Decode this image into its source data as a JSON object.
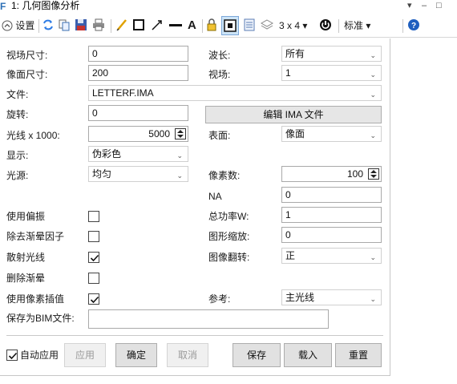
{
  "window": {
    "title": "1: 几何图像分析",
    "icon_letter": "F",
    "controls": [
      "▾",
      "–",
      "□"
    ]
  },
  "toolbar": {
    "settings_label": "设置",
    "grid_label": "3 x 4 ▾",
    "standard_label": "标准 ▾",
    "text_tool": "A"
  },
  "form": {
    "field_size": {
      "label": "视场尺寸:",
      "value": "0"
    },
    "image_size": {
      "label": "像面尺寸:",
      "value": "200"
    },
    "file": {
      "label": "文件:",
      "value": "LETTERF.IMA"
    },
    "rotation": {
      "label": "旋转:",
      "value": "0"
    },
    "rays": {
      "label": "光线 x 1000:",
      "value": "5000"
    },
    "display": {
      "label": "显示:",
      "value": "伪彩色"
    },
    "source": {
      "label": "光源:",
      "value": "均匀"
    },
    "wavelength": {
      "label": "波长:",
      "value": "所有"
    },
    "field": {
      "label": "视场:",
      "value": "1"
    },
    "edit_ima_button": "编辑 IMA 文件",
    "surface": {
      "label": "表面:",
      "value": "像面"
    },
    "pixels": {
      "label": "像素数:",
      "value": "100"
    },
    "na": {
      "label": "NA",
      "value": "0"
    },
    "total_power": {
      "label": "总功率W:",
      "value": "1"
    },
    "figure_scale": {
      "label": "图形缩放:",
      "value": "0"
    },
    "image_flip": {
      "label": "图像翻转:",
      "value": "正"
    },
    "reference": {
      "label": "参考:",
      "value": "主光线"
    },
    "use_polarization": {
      "label": "使用偏振",
      "checked": false
    },
    "remove_vignetting": {
      "label": "除去渐晕因子",
      "checked": false
    },
    "scatter_rays": {
      "label": "散射光线",
      "checked": true
    },
    "delete_vignetting": {
      "label": "删除渐晕",
      "checked": false
    },
    "pixel_interpolation": {
      "label": "使用像素插值",
      "checked": true
    },
    "save_bim": {
      "label": "保存为BIM文件:",
      "value": ""
    }
  },
  "footer": {
    "auto_apply": {
      "label": "自动应用",
      "checked": true
    },
    "apply": "应用",
    "ok": "确定",
    "cancel": "取消",
    "save": "保存",
    "load": "载入",
    "reset": "重置"
  }
}
